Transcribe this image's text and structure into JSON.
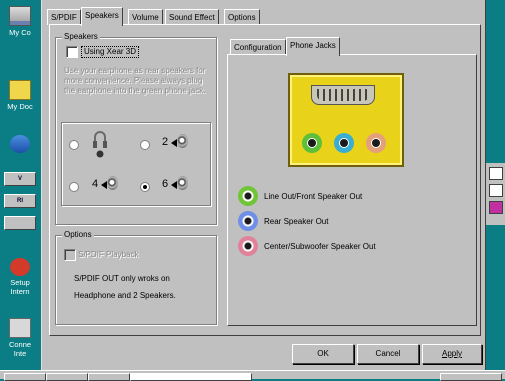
{
  "desktop": {
    "icons": [
      {
        "label": "My Co",
        "kind": "computer"
      },
      {
        "label": "My Doc",
        "kind": "documents"
      },
      {
        "label": "",
        "kind": "network"
      },
      {
        "label": "Setup Intern",
        "kind": "setup"
      },
      {
        "label": "Conne Inte",
        "kind": "connect"
      }
    ],
    "left_buttons": [
      "V",
      "RI",
      ""
    ]
  },
  "dialog": {
    "tabs": [
      {
        "label": "S/PDIF",
        "active": false
      },
      {
        "label": "Speakers",
        "active": true
      },
      {
        "label": "Volume",
        "active": false
      },
      {
        "label": "Sound Effect",
        "active": false
      },
      {
        "label": "Options",
        "active": false
      }
    ],
    "speakers_group": {
      "title": "Speakers",
      "xear_label": "Using Xear 3D",
      "xear_checked": false,
      "hint": "Use your earphone as rear speakers for more convenience. Please always plug the earphone into the green phone jack.",
      "speaker_options": [
        {
          "label": "2",
          "selected": false,
          "icon": "speaker-icon"
        },
        {
          "label": "4",
          "selected": false,
          "icon": "speaker-icon"
        },
        {
          "label": "6",
          "selected": true,
          "icon": "speaker-icon"
        }
      ]
    },
    "options_group": {
      "title": "Options",
      "spdif_playback_label": "S/PDIF Playback",
      "spdif_playback_checked": false,
      "note": "S/PDIF OUT only wroks on Headphone and 2 Speakers."
    },
    "right_tabs": [
      {
        "label": "Configuration",
        "active": false
      },
      {
        "label": "Phone Jacks",
        "active": true
      }
    ],
    "jack_legend": [
      {
        "label": "Line Out/Front Speaker Out",
        "color": "#6fc43a"
      },
      {
        "label": "Rear Speaker Out",
        "color": "#6f8ee8"
      },
      {
        "label": "Center/Subwoofer Speaker Out",
        "color": "#e0829a"
      }
    ],
    "buttons": {
      "ok": "OK",
      "cancel": "Cancel",
      "apply": "Apply"
    }
  },
  "colors": {
    "desktop": "#0a7e84",
    "dialog_face": "#c0c0c0",
    "jack_panel": "#e9d21a",
    "jack_green": "#5fbf3a",
    "jack_blue": "#3aaed2",
    "jack_pink": "#e3a07a"
  }
}
